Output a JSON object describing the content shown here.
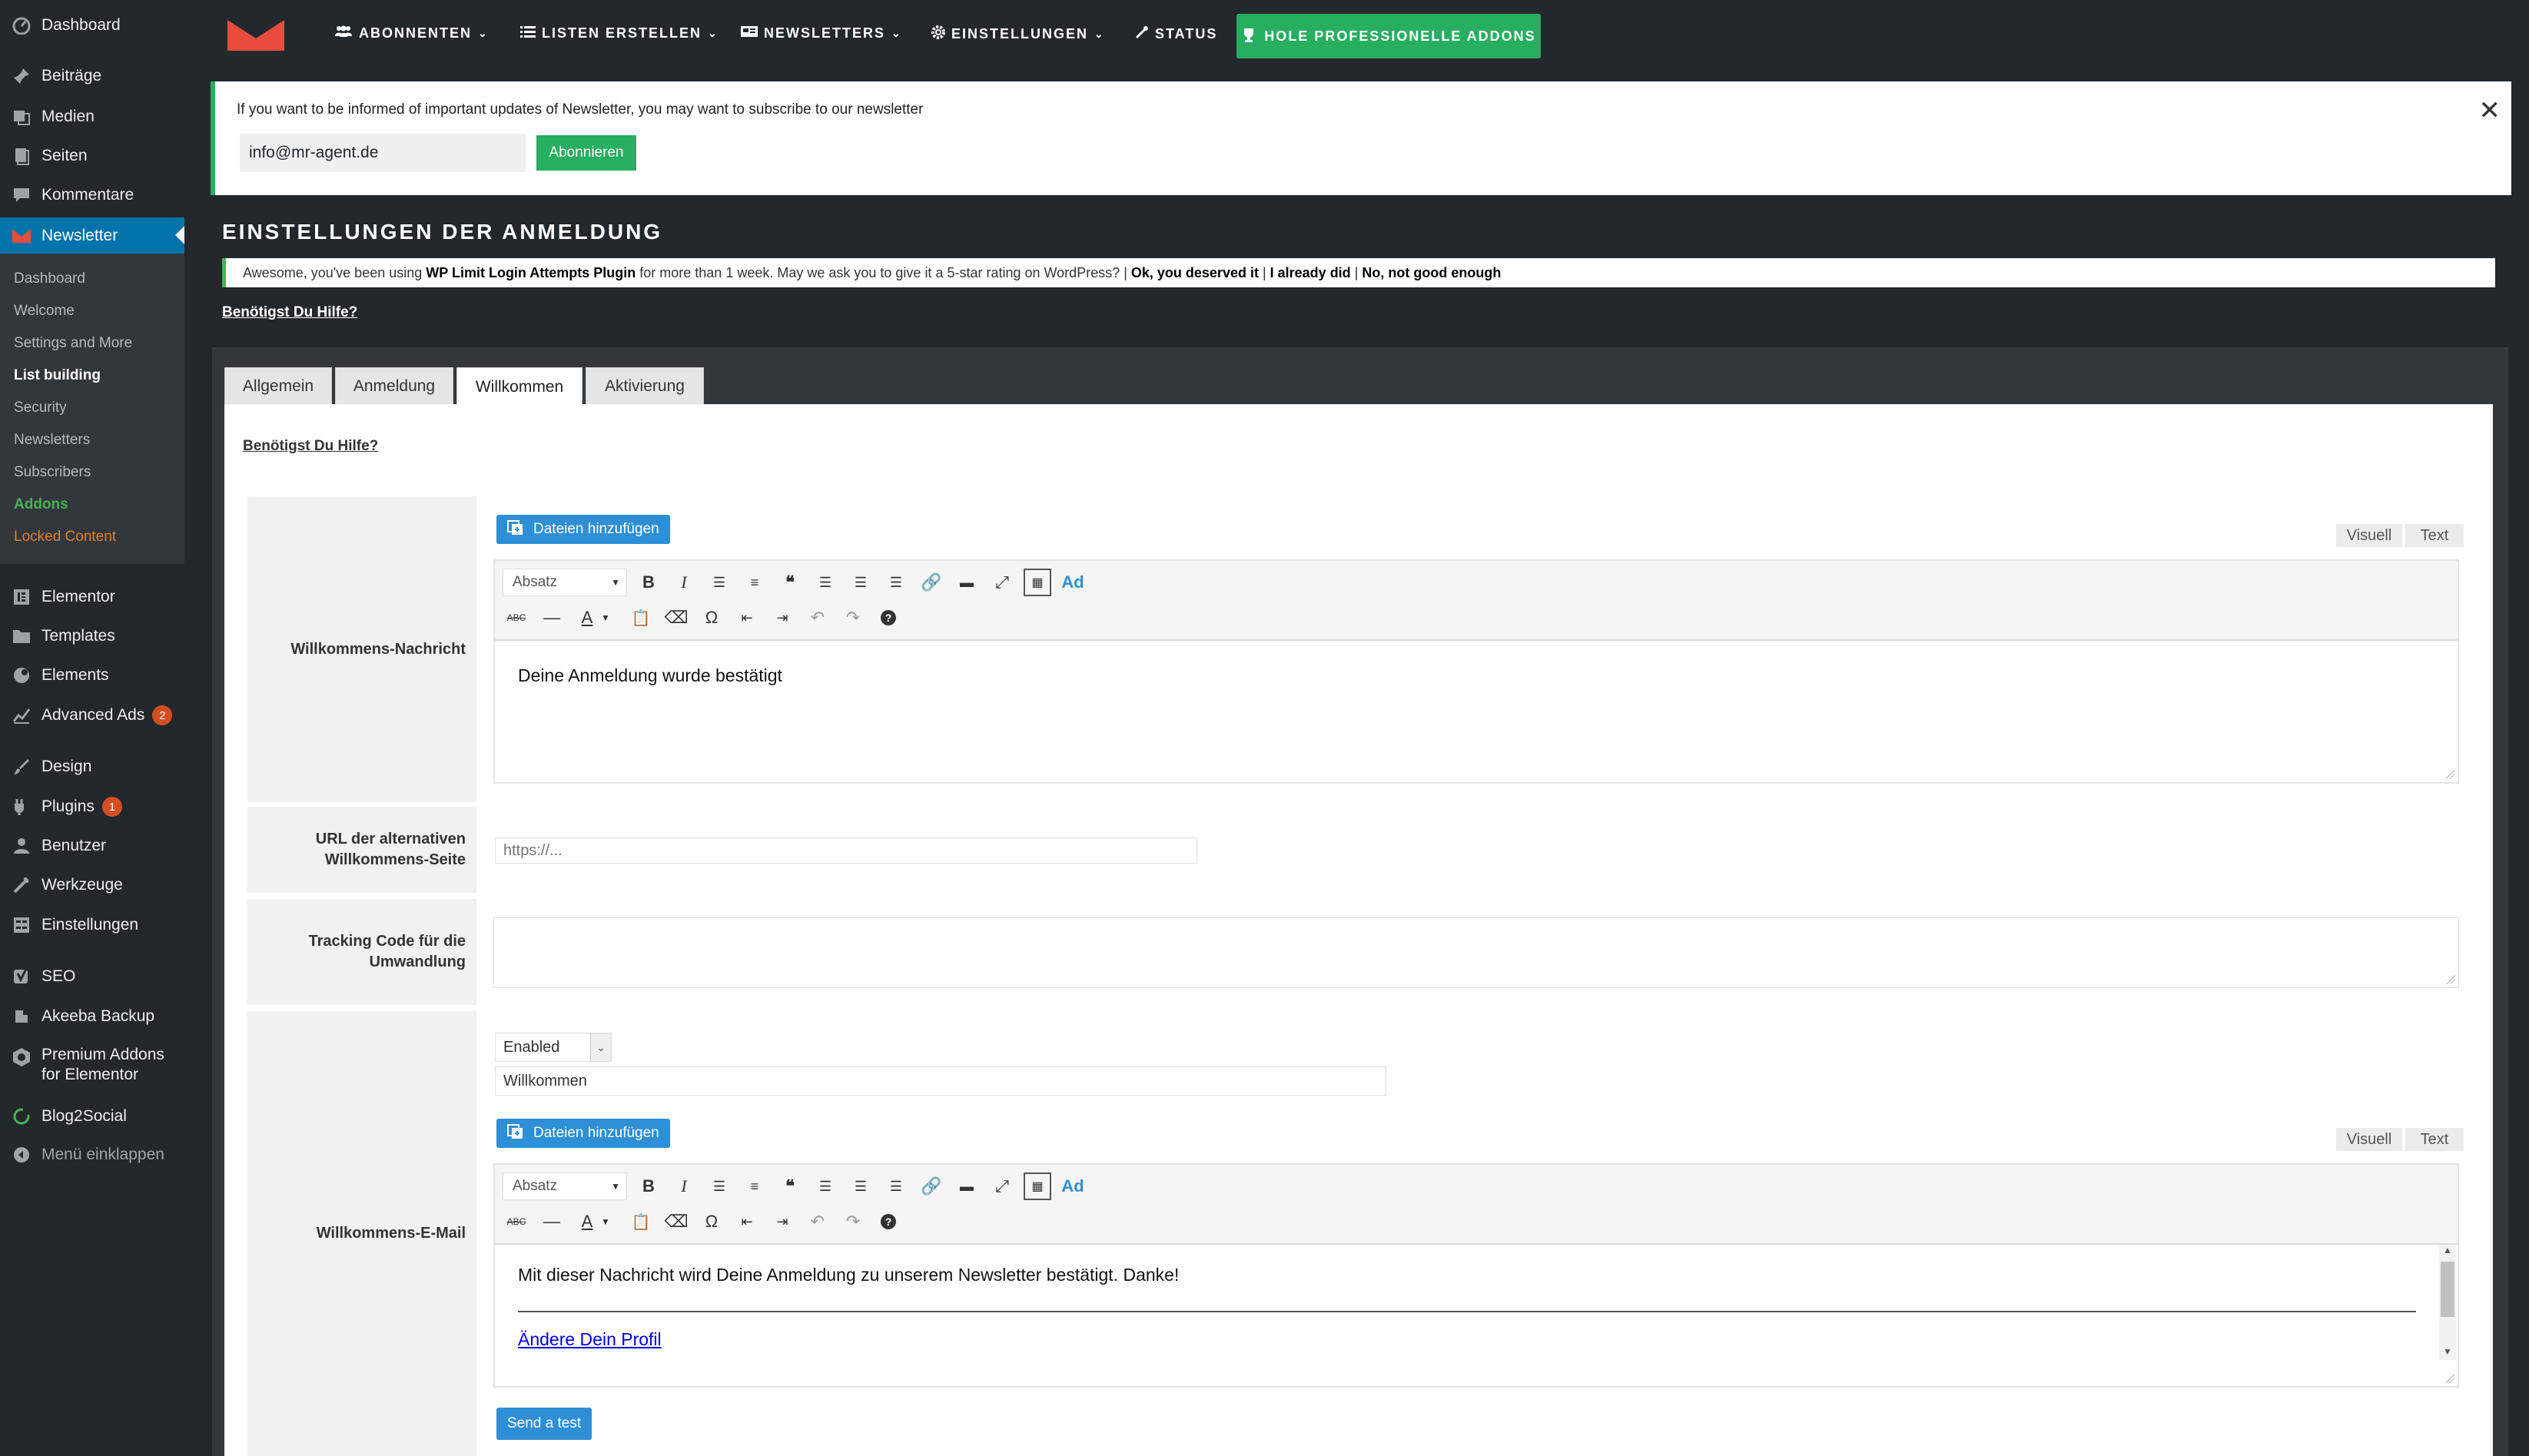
{
  "sidebar": {
    "top_items": [
      {
        "label": "Dashboard",
        "icon": "dashboard-icon"
      },
      {
        "label": "Beiträge",
        "icon": "pin-icon"
      },
      {
        "label": "Medien",
        "icon": "media-icon"
      },
      {
        "label": "Seiten",
        "icon": "pages-icon"
      },
      {
        "label": "Kommentare",
        "icon": "comment-icon"
      },
      {
        "label": "Newsletter",
        "icon": "newsletter-icon"
      }
    ],
    "submenu": [
      {
        "label": "Dashboard"
      },
      {
        "label": "Welcome"
      },
      {
        "label": "Settings and More"
      },
      {
        "label": "List building"
      },
      {
        "label": "Security"
      },
      {
        "label": "Newsletters"
      },
      {
        "label": "Subscribers"
      },
      {
        "label": "Addons"
      },
      {
        "label": "Locked Content"
      }
    ],
    "bottom_items": [
      {
        "label": "Elementor",
        "icon": "elementor-icon"
      },
      {
        "label": "Templates",
        "icon": "folder-icon"
      },
      {
        "label": "Elements",
        "icon": "elements-icon"
      },
      {
        "label": "Advanced Ads",
        "icon": "chart-icon",
        "badge": "2"
      },
      {
        "label": "Design",
        "icon": "brush-icon"
      },
      {
        "label": "Plugins",
        "icon": "plugin-icon",
        "badge": "1"
      },
      {
        "label": "Benutzer",
        "icon": "user-icon"
      },
      {
        "label": "Werkzeuge",
        "icon": "wrench-icon"
      },
      {
        "label": "Einstellungen",
        "icon": "settings-icon"
      },
      {
        "label": "SEO",
        "icon": "seo-icon"
      },
      {
        "label": "Akeeba Backup",
        "icon": "backup-icon"
      },
      {
        "label": "Premium Addons",
        "label2": "for Elementor",
        "icon": "premium-icon"
      },
      {
        "label": "Blog2Social",
        "icon": "blog2social-icon"
      },
      {
        "label": "Menü einklappen",
        "icon": "collapse-icon"
      }
    ]
  },
  "topnav": {
    "items": [
      "ABONNENTEN",
      "LISTEN ERSTELLEN",
      "NEWSLETTERS",
      "EINSTELLUNGEN",
      "STATUS"
    ],
    "pro_label": "HOLE PROFESSIONELLE ADDONS"
  },
  "notice": {
    "text": "If you want to be informed of important updates of Newsletter, you may want to subscribe to our newsletter",
    "email_value": "info@mr-agent.de",
    "subscribe_label": "Abonnieren",
    "close": "✕"
  },
  "page": {
    "title": "EINSTELLUNGEN DER ANMELDUNG",
    "rating_notice": {
      "pre": "Awesome, you've been using ",
      "plugin": "WP Limit Login Attempts Plugin",
      "mid": " for more than 1 week. May we ask you to give it a 5-star rating on WordPress? | ",
      "opt1": "Ok, you deserved it",
      "sep1": " | ",
      "opt2": "I already did",
      "sep2": " | ",
      "opt3": "No, not good enough"
    },
    "help": "Benötigst Du Hilfe?"
  },
  "tabs": [
    "Allgemein",
    "Anmeldung",
    "Willkommen",
    "Aktivierung"
  ],
  "form": {
    "welcome_message": {
      "label": "Willkommens-Nachricht",
      "add_media": "Dateien hinzufügen",
      "visual": "Visuell",
      "text": "Text",
      "format": "Absatz",
      "content": "Deine Anmeldung wurde bestätigt"
    },
    "alt_url": {
      "label": "URL der alternativen Willkommens-Seite",
      "placeholder": "https://..."
    },
    "tracking": {
      "label": "Tracking Code für die Umwandlung"
    },
    "welcome_email": {
      "label": "Willkommens-E-Mail",
      "status": "Enabled",
      "subject": "Willkommen",
      "add_media": "Dateien hinzufügen",
      "visual": "Visuell",
      "text": "Text",
      "format": "Absatz",
      "content": "Mit dieser Nachricht wird Deine Anmeldung zu unserem Newsletter bestätigt. Danke!",
      "profile_link": "Ändere Dein Profil",
      "send_test": "Send a test"
    }
  },
  "colors": {
    "admin_bg": "#23282d",
    "active_blue": "#0073aa",
    "green": "#27ae60",
    "button_blue": "#2e8fd6",
    "logo_red": "#e74c3c"
  }
}
